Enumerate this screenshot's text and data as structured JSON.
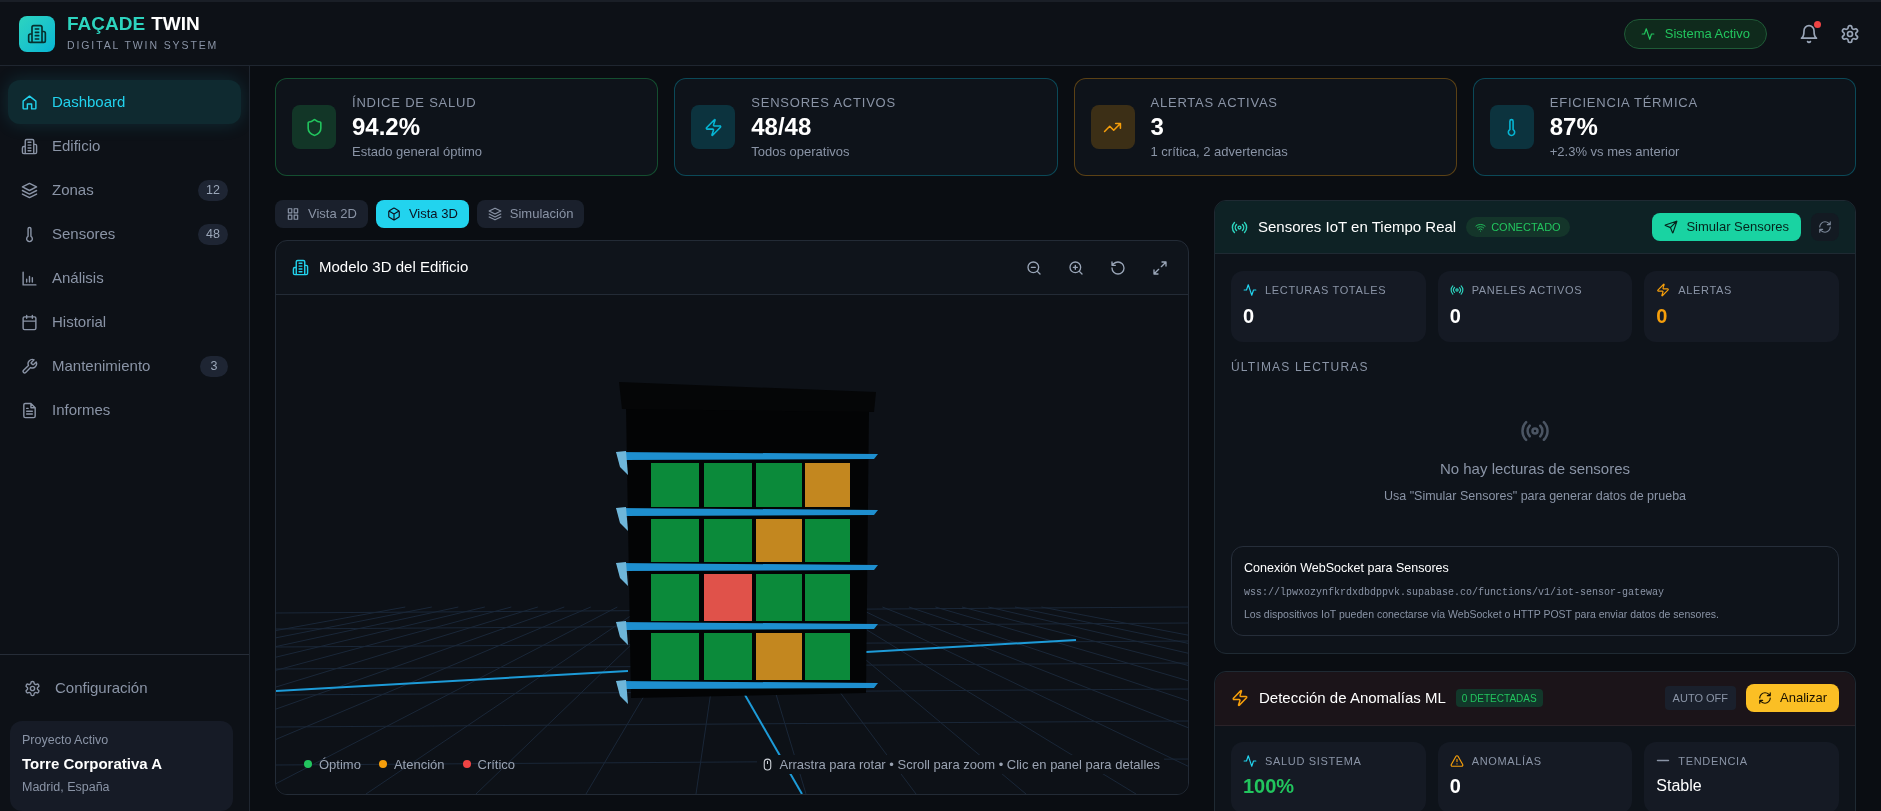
{
  "header": {
    "brand_accent": "FAÇADE",
    "brand_rest": "TWIN",
    "subtitle": "DIGITAL TWIN SYSTEM",
    "status_pill": "Sistema Activo",
    "notifications_unread": true
  },
  "sidebar": {
    "items": [
      {
        "label": "Dashboard",
        "selected": true
      },
      {
        "label": "Edificio",
        "selected": false
      },
      {
        "label": "Zonas",
        "badge": "12",
        "selected": false
      },
      {
        "label": "Sensores",
        "badge": "48",
        "selected": false
      },
      {
        "label": "Análisis",
        "selected": false
      },
      {
        "label": "Historial",
        "selected": false
      },
      {
        "label": "Mantenimiento",
        "badge": "3",
        "selected": false
      },
      {
        "label": "Informes",
        "selected": false
      }
    ],
    "settings": "Configuración",
    "project": {
      "caption": "Proyecto Activo",
      "name": "Torre Corporativa A",
      "location": "Madrid, España"
    }
  },
  "stats": [
    {
      "label": "ÍNDICE DE SALUD",
      "value": "94.2%",
      "note": "Estado general óptimo",
      "color": "#22c55e"
    },
    {
      "label": "SENSORES ACTIVOS",
      "value": "48/48",
      "note": "Todos operativos",
      "color": "#06b6d4"
    },
    {
      "label": "ALERTAS ACTIVAS",
      "value": "3",
      "note": "1 crítica, 2 advertencias",
      "color": "#f59e0b"
    },
    {
      "label": "EFICIENCIA TÉRMICA",
      "value": "87%",
      "note": "+2.3% vs mes anterior",
      "color": "#06b6d4"
    }
  ],
  "view_tabs": [
    {
      "label": "Vista 2D",
      "selected": false
    },
    {
      "label": "Vista 3D",
      "selected": true
    },
    {
      "label": "Simulación",
      "selected": false
    }
  ],
  "viewer": {
    "title": "Modelo 3D del Edificio",
    "floors": [
      [
        {
          "color": "#0b8a3a"
        },
        {
          "color": "#0b8a3a"
        },
        {
          "color": "#0b8a3a"
        },
        {
          "color": "#c3871f"
        }
      ],
      [
        {
          "color": "#0b8a3a"
        },
        {
          "color": "#0b8a3a"
        },
        {
          "color": "#c3871f"
        },
        {
          "color": "#0b8a3a"
        }
      ],
      [
        {
          "color": "#0b8a3a"
        },
        {
          "color": "#e0524a"
        },
        {
          "color": "#0b8a3a"
        },
        {
          "color": "#0b8a3a"
        }
      ],
      [
        {
          "color": "#0b8a3a"
        },
        {
          "color": "#0b8a3a"
        },
        {
          "color": "#c3871f"
        },
        {
          "color": "#0b8a3a"
        }
      ]
    ],
    "legend": [
      {
        "label": "Óptimo",
        "color": "#22c55e"
      },
      {
        "label": "Atención",
        "color": "#f59e0b"
      },
      {
        "label": "Crítico",
        "color": "#ef4444"
      }
    ],
    "hint": "Arrastra para rotar • Scroll para zoom • Clic en panel para detalles"
  },
  "iot_panel": {
    "title": "Sensores IoT en Tiempo Real",
    "badge": "CONECTADO",
    "action": "Simular Sensores",
    "tiles": [
      {
        "label": "LECTURAS TOTALES",
        "value": "0",
        "color": "#ffffff"
      },
      {
        "label": "PANELES ACTIVOS",
        "value": "0",
        "color": "#ffffff"
      },
      {
        "label": "ALERTAS",
        "value": "0",
        "color": "#f59e0b"
      }
    ],
    "section": "ÚLTIMAS LECTURAS",
    "empty_title": "No hay lecturas de sensores",
    "empty_hint": "Usa \"Simular Sensores\" para generar datos de prueba",
    "websocket": {
      "title": "Conexión WebSocket para Sensores",
      "url": "wss://lpwxozynfkrdxdbdppvk.supabase.co/functions/v1/iot-sensor-gateway",
      "note": "Los dispositivos IoT pueden conectarse vía WebSocket o HTTP POST para enviar datos de sensores."
    }
  },
  "anomaly_panel": {
    "title": "Detección de Anomalías ML",
    "badge": "0 DETECTADAS",
    "auto": "AUTO OFF",
    "action": "Analizar",
    "tiles": [
      {
        "label": "SALUD SISTEMA",
        "value": "100%",
        "color": "#22c55e",
        "kind": "metric"
      },
      {
        "label": "ANOMALÍAS",
        "value": "0",
        "color": "#ffffff",
        "kind": "metric"
      },
      {
        "label": "TENDENCIA",
        "value": "Stable",
        "color": "#ffffff",
        "kind": "text"
      }
    ]
  }
}
